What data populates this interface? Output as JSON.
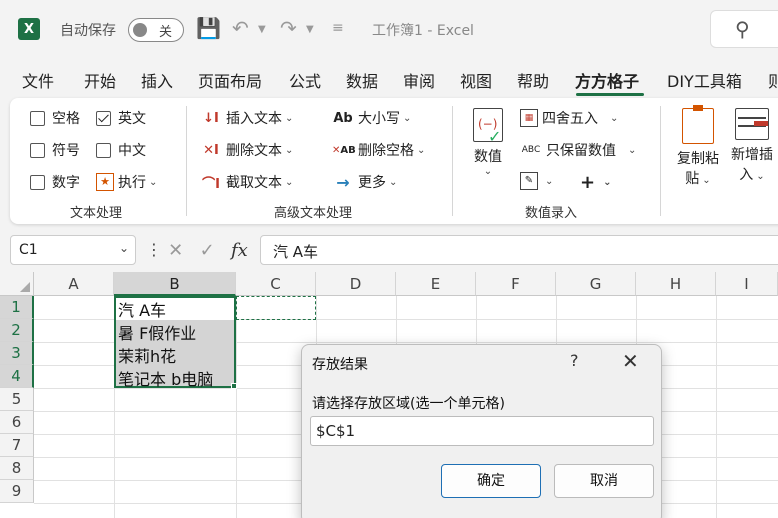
{
  "app": {
    "logo": "X",
    "autosave_label": "自动保存",
    "autosave_state": "关",
    "doc_title": "工作簿1  -  Excel",
    "icons": [
      "save-icon",
      "undo-icon",
      "redo-icon",
      "search-icon"
    ]
  },
  "menu": {
    "tabs": [
      "文件",
      "开始",
      "插入",
      "页面布局",
      "公式",
      "数据",
      "审阅",
      "视图",
      "帮助",
      "方方格子",
      "DIY工具箱",
      "则"
    ],
    "active": "方方格子"
  },
  "ribbon": {
    "text_processing": {
      "options": [
        {
          "label": "空格",
          "checked": false
        },
        {
          "label": "英文",
          "checked": true
        },
        {
          "label": "符号",
          "checked": false
        },
        {
          "label": "中文",
          "checked": false
        },
        {
          "label": "数字",
          "checked": false
        }
      ],
      "execute_label": "执行",
      "group_label": "文本处理"
    },
    "advanced_text": {
      "insert_text": "插入文本",
      "delete_text": "删除文本",
      "extract_text": "截取文本",
      "case": "大小写",
      "delete_space": "删除空格",
      "more": "更多",
      "group_label": "高级文本处理",
      "icon_case": "Ab",
      "icon_space": "AB"
    },
    "numeric_entry": {
      "value_label": "数值",
      "round": "四舍五入",
      "keep_values": "只保留数值",
      "plus": "+",
      "icon_abc": "ABC",
      "group_label": "数值录入"
    },
    "copy_paste_label_1": "复制粘",
    "copy_paste_label_2": "贴",
    "new_insert_label_1": "新增插",
    "new_insert_label_2": "入"
  },
  "formula_bar": {
    "name_box": "C1",
    "fx": "fx",
    "formula": "汽 A车"
  },
  "sheet": {
    "columns": [
      "A",
      "B",
      "C",
      "D",
      "E",
      "F",
      "G",
      "H",
      "I"
    ],
    "rows": [
      "1",
      "2",
      "3",
      "4",
      "5",
      "6",
      "7",
      "8",
      "9"
    ],
    "cells": {
      "B1": "汽 A车",
      "B2": "暑 F假作业",
      "B3": "茉莉h花",
      "B4": "笔记本 b电脑"
    }
  },
  "dialog": {
    "title": "存放结果",
    "help": "?",
    "close": "✕",
    "prompt": "请选择存放区域(选一个单元格)",
    "value": "$C$1",
    "ok": "确定",
    "cancel": "取消"
  }
}
